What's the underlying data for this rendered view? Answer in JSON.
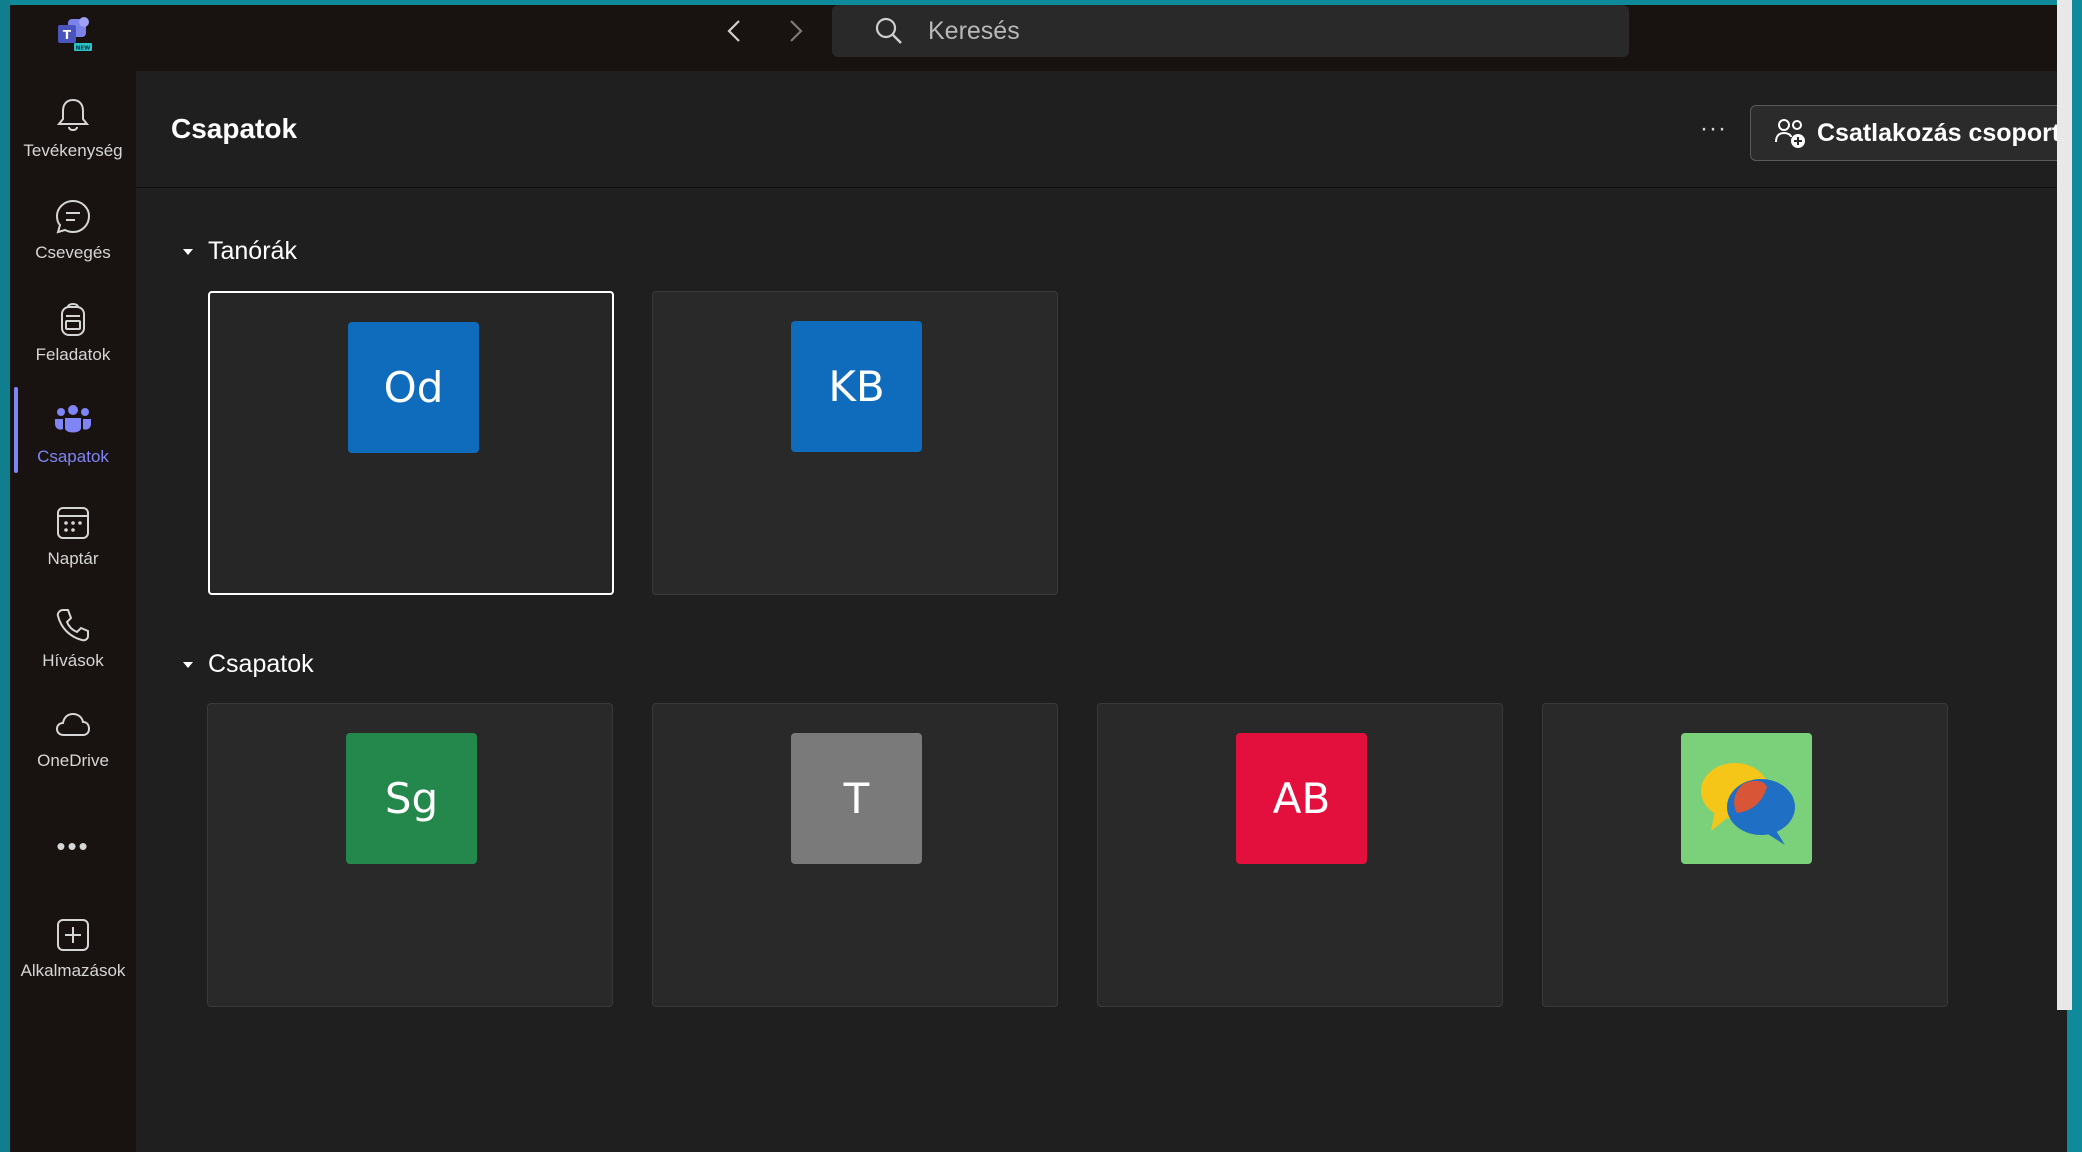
{
  "search": {
    "placeholder": "Keresés"
  },
  "rail": {
    "items": [
      {
        "label": "Tevékenység",
        "icon": "bell-icon"
      },
      {
        "label": "Csevegés",
        "icon": "chat-icon"
      },
      {
        "label": "Feladatok",
        "icon": "backpack-icon"
      },
      {
        "label": "Csapatok",
        "icon": "teams-icon",
        "active": true
      },
      {
        "label": "Naptár",
        "icon": "calendar-icon"
      },
      {
        "label": "Hívások",
        "icon": "phone-icon"
      },
      {
        "label": "OneDrive",
        "icon": "cloud-icon"
      },
      {
        "label": "Alkalmazások",
        "icon": "add-apps-icon"
      }
    ],
    "more": "•••"
  },
  "header": {
    "title": "Csapatok",
    "more": "···",
    "join_label": "Csatlakozás csoporthoz"
  },
  "sections": [
    {
      "title": "Tanórák",
      "cards": [
        {
          "initials": "Od",
          "color": "#0f6cbd"
        },
        {
          "initials": "KB",
          "color": "#0f6cbd"
        }
      ]
    },
    {
      "title": "Csapatok",
      "cards": [
        {
          "initials": "Sg",
          "color": "#24874b"
        },
        {
          "initials": "T",
          "color": "#7a7a7a"
        },
        {
          "initials": "AB",
          "color": "#e3103e"
        },
        {
          "initials": "",
          "color": "#7bd17a",
          "icon": "speech-bubbles-icon"
        }
      ]
    }
  ],
  "colors": {
    "accent": "#7f85f5",
    "tile_blue": "#0f6cbd",
    "tile_green": "#24874b",
    "tile_gray": "#7a7a7a",
    "tile_red": "#e3103e"
  }
}
